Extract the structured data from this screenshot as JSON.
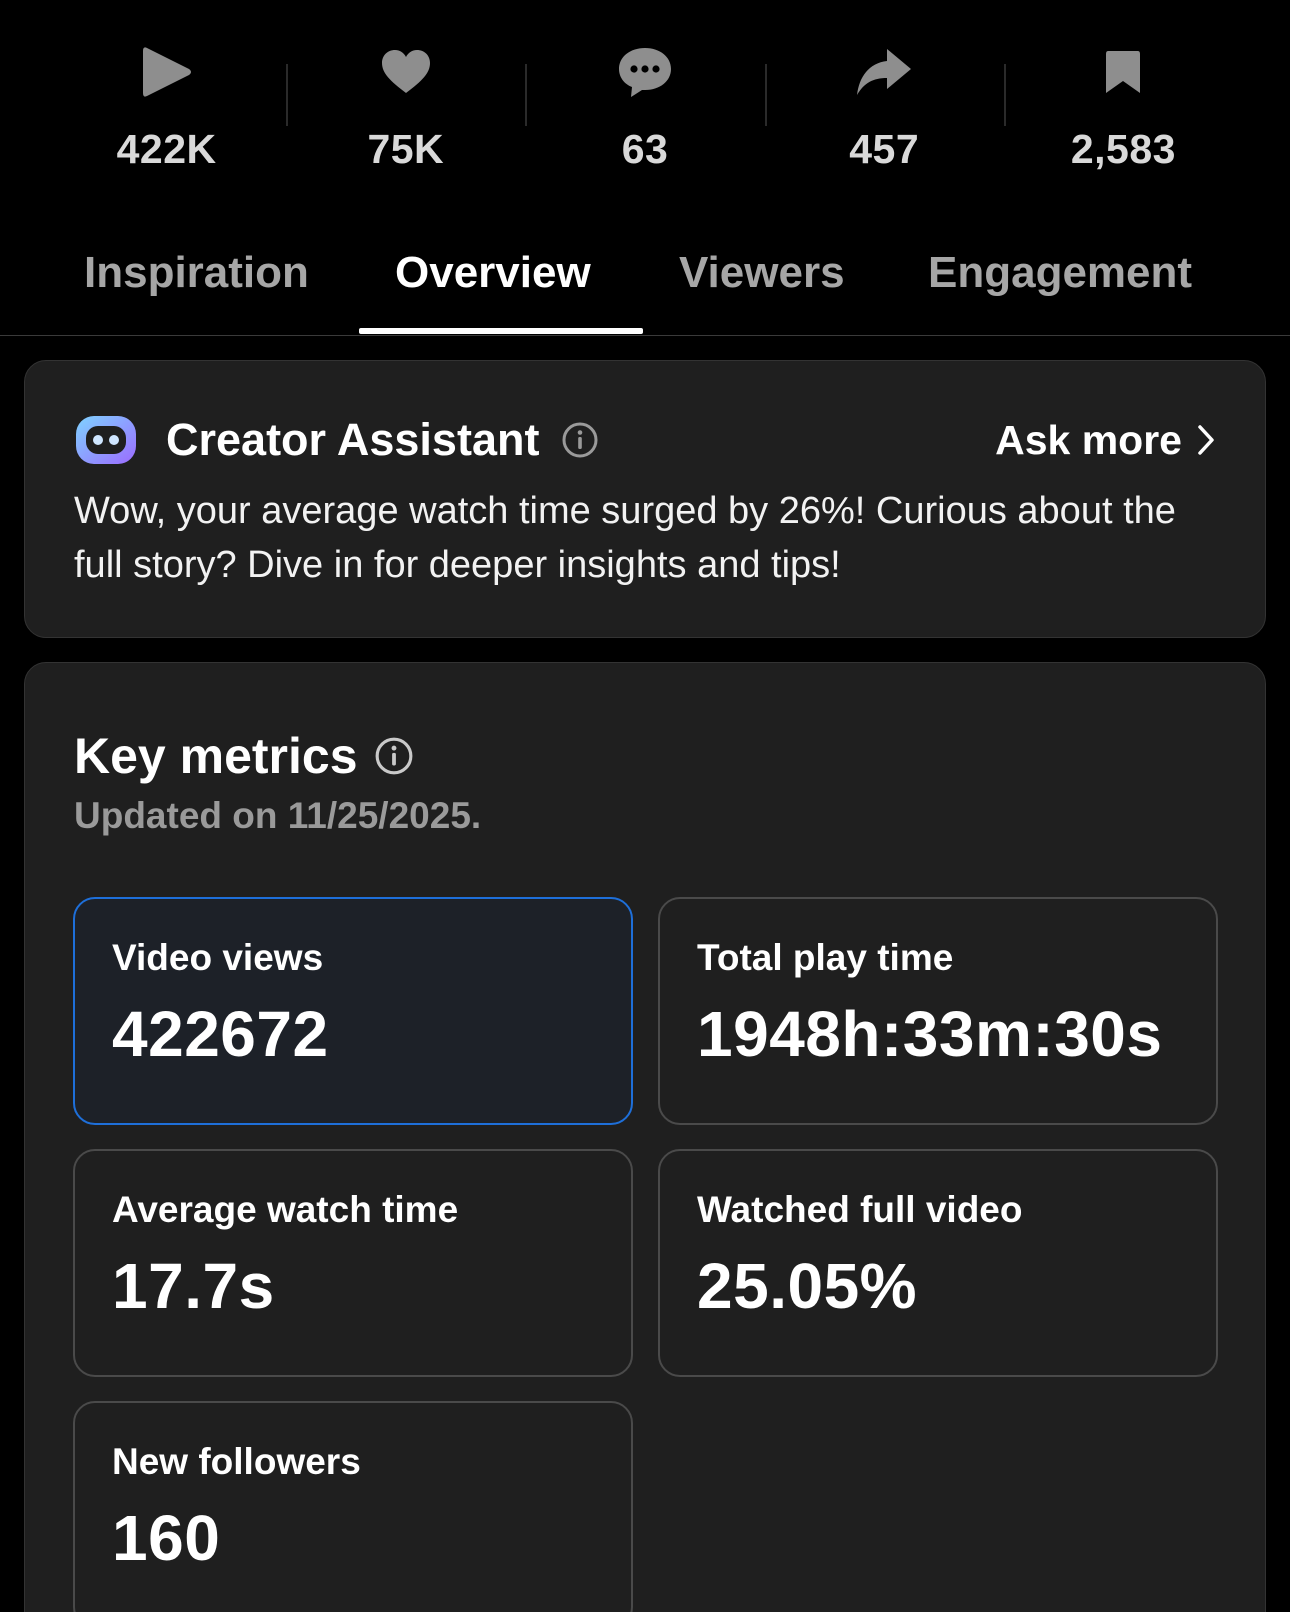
{
  "stats": [
    {
      "icon": "play-icon",
      "value": "422K"
    },
    {
      "icon": "heart-icon",
      "value": "75K"
    },
    {
      "icon": "comment-icon",
      "value": "63"
    },
    {
      "icon": "share-icon",
      "value": "457"
    },
    {
      "icon": "bookmark-icon",
      "value": "2,583"
    }
  ],
  "tabs": [
    {
      "label": "Inspiration",
      "active": false
    },
    {
      "label": "Overview",
      "active": true
    },
    {
      "label": "Viewers",
      "active": false
    },
    {
      "label": "Engagement",
      "active": false
    }
  ],
  "assistant": {
    "icon": "creator-assistant-icon",
    "title": "Creator Assistant",
    "ask_more": "Ask more",
    "message": "Wow, your average watch time surged by 26%! Curious about the full story? Dive in for deeper insights and tips!"
  },
  "key_metrics": {
    "title": "Key metrics",
    "updated": "Updated on 11/25/2025.",
    "items": [
      {
        "label": "Video views",
        "value": "422672",
        "selected": true
      },
      {
        "label": "Total play time",
        "value": "1948h:33m:30s",
        "selected": false
      },
      {
        "label": "Average watch time",
        "value": "17.7s",
        "selected": false
      },
      {
        "label": "Watched full video",
        "value": "25.05%",
        "selected": false
      },
      {
        "label": "New followers",
        "value": "160",
        "selected": false
      }
    ]
  },
  "colors": {
    "background": "#000000",
    "card": "#1f1f1f",
    "selected_border": "#1e6fd9",
    "muted_text": "#9a9a9a"
  }
}
